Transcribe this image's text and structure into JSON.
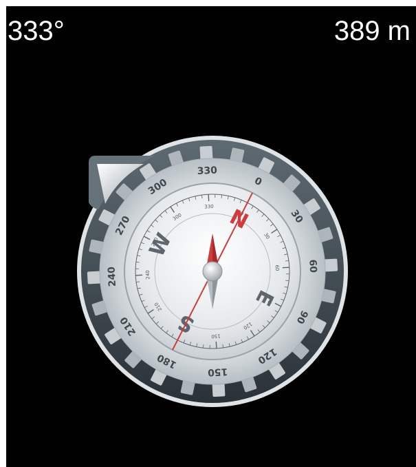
{
  "status": {
    "heading": "333°",
    "altitude": "389 m"
  },
  "compass": {
    "heading_degrees": 333,
    "bezel_labels": [
      "0",
      "30",
      "60",
      "90",
      "120",
      "150",
      "180",
      "210",
      "240",
      "270",
      "300",
      "330"
    ],
    "face_tick_labels": [
      "0",
      "30",
      "60",
      "90",
      "120",
      "150",
      "180",
      "210",
      "240",
      "270",
      "300",
      "330"
    ],
    "cardinals": {
      "north": "N",
      "east": "E",
      "south": "S",
      "west": "W"
    },
    "colors": {
      "needle_red": "#d03c3c",
      "north_line": "#cf3b3b",
      "bezel": "#7f8c94",
      "face": "#e8ebee"
    }
  }
}
